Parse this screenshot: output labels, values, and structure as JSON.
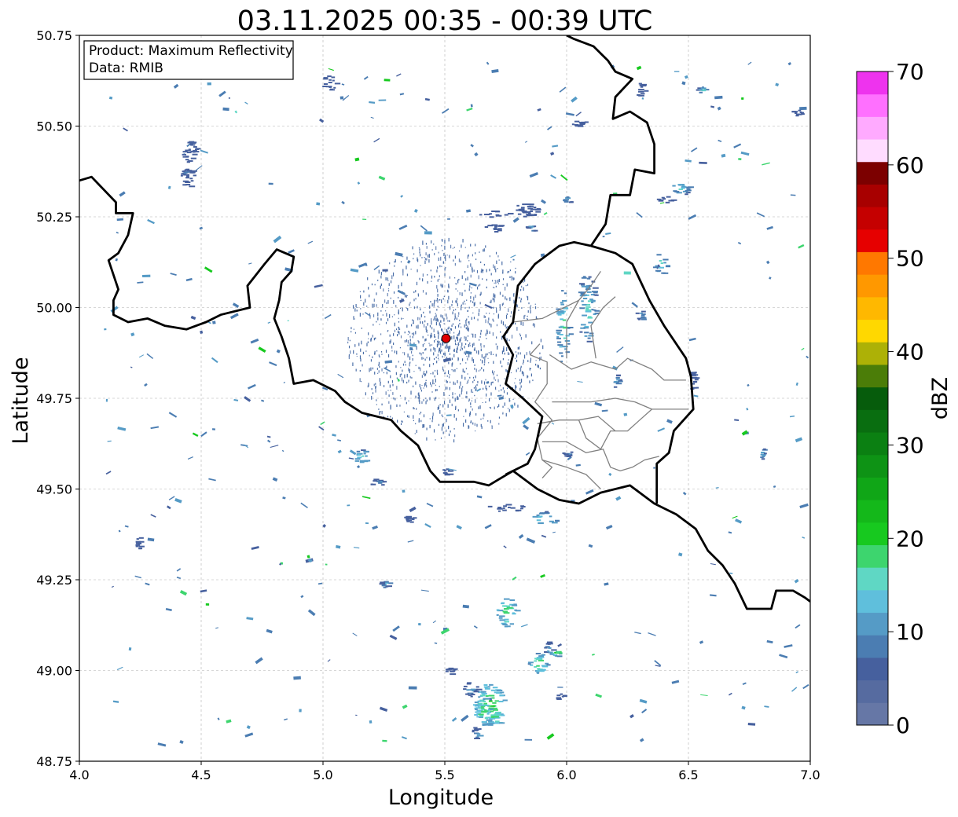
{
  "title": "03.11.2025 00:35 - 00:39 UTC",
  "x_axis": {
    "label": "Longitude",
    "min": 4.0,
    "max": 7.0,
    "ticks": [
      "4.0",
      "4.5",
      "5.0",
      "5.5",
      "6.0",
      "6.5",
      "7.0"
    ]
  },
  "y_axis": {
    "label": "Latitude",
    "min": 48.75,
    "max": 50.75,
    "ticks": [
      "48.75",
      "49.00",
      "49.25",
      "49.50",
      "49.75",
      "50.00",
      "50.25",
      "50.50",
      "50.75"
    ]
  },
  "info_box": {
    "line1": "Product: Maximum Reflectivity",
    "line2": "Data: RMIB"
  },
  "colorbar": {
    "label": "dBZ",
    "min": 0,
    "max": 70,
    "ticks": [
      "0",
      "10",
      "20",
      "30",
      "40",
      "50",
      "60",
      "70"
    ],
    "colors": [
      "#6677a6",
      "#566ba0",
      "#46609e",
      "#4b7db2",
      "#559bc6",
      "#5fbfdc",
      "#5fd7c4",
      "#3dd56e",
      "#17c91f",
      "#14b81a",
      "#10a617",
      "#0e9315",
      "#0b8012",
      "#096e10",
      "#065c0c",
      "#4b7d08",
      "#adb106",
      "#ffd800",
      "#ffb800",
      "#ff9800",
      "#ff7800",
      "#e60000",
      "#c50000",
      "#a80000",
      "#7c0000",
      "#ffdcff",
      "#ffaaff",
      "#ff70ff",
      "#ee33ee"
    ]
  },
  "radar_site": {
    "lon": 5.505,
    "lat": 49.915,
    "color": "#e00000"
  },
  "borders": {
    "national": [
      [
        [
          4.0,
          50.35
        ],
        [
          4.05,
          50.36
        ],
        [
          4.15,
          50.29
        ],
        [
          4.15,
          50.26
        ],
        [
          4.22,
          50.26
        ],
        [
          4.2,
          50.2
        ],
        [
          4.16,
          50.15
        ],
        [
          4.12,
          50.13
        ],
        [
          4.16,
          50.05
        ],
        [
          4.14,
          50.02
        ],
        [
          4.14,
          49.98
        ],
        [
          4.2,
          49.96
        ],
        [
          4.28,
          49.97
        ],
        [
          4.35,
          49.95
        ],
        [
          4.44,
          49.94
        ],
        [
          4.52,
          49.96
        ],
        [
          4.58,
          49.98
        ],
        [
          4.7,
          50.0
        ],
        [
          4.69,
          50.06
        ],
        [
          4.76,
          50.12
        ],
        [
          4.81,
          50.16
        ],
        [
          4.88,
          50.14
        ],
        [
          4.87,
          50.1
        ],
        [
          4.83,
          50.07
        ],
        [
          4.82,
          50.02
        ],
        [
          4.8,
          49.97
        ],
        [
          4.83,
          49.92
        ],
        [
          4.86,
          49.86
        ],
        [
          4.88,
          49.79
        ],
        [
          4.96,
          49.8
        ],
        [
          5.05,
          49.77
        ],
        [
          5.09,
          49.74
        ],
        [
          5.16,
          49.71
        ],
        [
          5.28,
          49.69
        ],
        [
          5.32,
          49.66
        ],
        [
          5.39,
          49.62
        ],
        [
          5.44,
          49.55
        ],
        [
          5.48,
          49.52
        ],
        [
          5.55,
          49.52
        ],
        [
          5.62,
          49.52
        ],
        [
          5.68,
          49.51
        ],
        [
          5.78,
          49.55
        ],
        [
          5.88,
          49.5
        ],
        [
          5.97,
          49.47
        ],
        [
          6.05,
          49.46
        ],
        [
          6.14,
          49.49
        ],
        [
          6.26,
          49.51
        ],
        [
          6.36,
          49.46
        ],
        [
          6.45,
          49.43
        ],
        [
          6.53,
          49.39
        ],
        [
          6.58,
          49.33
        ],
        [
          6.64,
          49.29
        ],
        [
          6.69,
          49.24
        ],
        [
          6.74,
          49.17
        ],
        [
          6.84,
          49.17
        ],
        [
          6.86,
          49.22
        ],
        [
          6.93,
          49.22
        ],
        [
          6.98,
          49.2
        ],
        [
          7.0,
          49.19
        ]
      ],
      [
        [
          6.1,
          50.17
        ],
        [
          6.2,
          50.15
        ],
        [
          6.27,
          50.12
        ],
        [
          6.34,
          50.02
        ],
        [
          6.4,
          49.95
        ],
        [
          6.49,
          49.86
        ],
        [
          6.51,
          49.81
        ],
        [
          6.52,
          49.72
        ],
        [
          6.44,
          49.66
        ],
        [
          6.42,
          49.6
        ],
        [
          6.37,
          49.57
        ],
        [
          6.37,
          49.46
        ]
      ],
      [
        [
          5.75,
          49.54
        ],
        [
          5.84,
          49.57
        ],
        [
          5.87,
          49.61
        ],
        [
          5.9,
          49.7
        ],
        [
          5.82,
          49.75
        ],
        [
          5.75,
          49.79
        ],
        [
          5.78,
          49.87
        ],
        [
          5.74,
          49.92
        ],
        [
          5.78,
          49.96
        ],
        [
          5.8,
          50.06
        ],
        [
          5.87,
          50.12
        ],
        [
          5.97,
          50.17
        ],
        [
          6.03,
          50.18
        ],
        [
          6.1,
          50.17
        ]
      ],
      [
        [
          6.1,
          50.17
        ],
        [
          6.16,
          50.23
        ],
        [
          6.18,
          50.31
        ],
        [
          6.26,
          50.31
        ],
        [
          6.28,
          50.38
        ],
        [
          6.36,
          50.37
        ],
        [
          6.36,
          50.45
        ],
        [
          6.33,
          50.51
        ],
        [
          6.26,
          50.54
        ],
        [
          6.19,
          50.52
        ],
        [
          6.2,
          50.58
        ],
        [
          6.27,
          50.63
        ],
        [
          6.2,
          50.65
        ],
        [
          6.17,
          50.68
        ],
        [
          6.11,
          50.72
        ],
        [
          6.03,
          50.74
        ],
        [
          6.0,
          50.75
        ]
      ]
    ],
    "regional": [
      [
        [
          5.89,
          49.9
        ],
        [
          5.85,
          49.87
        ],
        [
          5.92,
          49.85
        ],
        [
          5.92,
          49.79
        ],
        [
          5.87,
          49.74
        ],
        [
          5.94,
          49.69
        ],
        [
          5.88,
          49.64
        ],
        [
          5.9,
          49.58
        ],
        [
          5.94,
          49.56
        ],
        [
          5.9,
          49.53
        ]
      ],
      [
        [
          5.93,
          49.87
        ],
        [
          6.02,
          49.83
        ],
        [
          6.1,
          49.85
        ],
        [
          6.2,
          49.83
        ],
        [
          6.25,
          49.86
        ],
        [
          6.35,
          49.83
        ],
        [
          6.4,
          49.8
        ],
        [
          6.49,
          49.8
        ]
      ],
      [
        [
          5.94,
          49.74
        ],
        [
          6.1,
          49.74
        ],
        [
          6.2,
          49.75
        ],
        [
          6.28,
          49.74
        ],
        [
          6.35,
          49.72
        ],
        [
          6.5,
          49.72
        ]
      ],
      [
        [
          6.0,
          49.86
        ],
        [
          6.0,
          49.96
        ],
        [
          6.05,
          50.02
        ],
        [
          6.1,
          50.06
        ],
        [
          6.14,
          50.1
        ]
      ],
      [
        [
          5.78,
          49.96
        ],
        [
          5.9,
          49.97
        ],
        [
          5.99,
          50.0
        ],
        [
          6.05,
          50.02
        ]
      ],
      [
        [
          6.12,
          49.86
        ],
        [
          6.1,
          49.95
        ],
        [
          6.15,
          50.0
        ],
        [
          6.2,
          50.03
        ]
      ],
      [
        [
          5.9,
          49.63
        ],
        [
          6.0,
          49.63
        ],
        [
          6.08,
          49.6
        ],
        [
          6.15,
          49.61
        ],
        [
          6.18,
          49.56
        ],
        [
          6.22,
          49.55
        ],
        [
          6.27,
          49.56
        ],
        [
          6.32,
          49.58
        ],
        [
          6.38,
          49.59
        ]
      ],
      [
        [
          5.9,
          49.58
        ],
        [
          6.0,
          49.56
        ],
        [
          6.08,
          49.54
        ],
        [
          6.14,
          49.5
        ]
      ],
      [
        [
          6.14,
          49.61
        ],
        [
          6.18,
          49.66
        ],
        [
          6.25,
          49.66
        ],
        [
          6.3,
          49.69
        ],
        [
          6.35,
          49.72
        ]
      ],
      [
        [
          5.88,
          49.68
        ],
        [
          5.97,
          49.69
        ],
        [
          6.05,
          49.69
        ],
        [
          6.13,
          49.7
        ],
        [
          6.2,
          49.66
        ]
      ],
      [
        [
          6.05,
          49.69
        ],
        [
          6.08,
          49.64
        ],
        [
          6.14,
          49.61
        ]
      ]
    ]
  },
  "echo_blobs": [
    [
      5.68,
      48.91,
      0.06,
      0.06,
      0.96,
      0.85
    ],
    [
      5.65,
      48.89,
      0.04,
      0.04,
      0.92,
      0.8
    ],
    [
      5.6,
      48.95,
      0.03,
      0.02,
      0.6,
      0.82
    ],
    [
      5.75,
      49.16,
      0.04,
      0.04,
      0.93,
      0.85
    ],
    [
      5.88,
      49.02,
      0.04,
      0.03,
      0.9,
      0.8
    ],
    [
      5.63,
      48.83,
      0.02,
      0.02,
      0.6,
      0.8
    ],
    [
      5.92,
      49.06,
      0.02,
      0.02,
      0.6,
      0.7
    ],
    [
      5.97,
      48.93,
      0.02,
      0.01,
      0.4,
      0.7
    ],
    [
      5.52,
      49.0,
      0.02,
      0.01,
      0.3,
      0.7
    ],
    [
      4.45,
      50.43,
      0.03,
      0.03,
      0.3,
      0.8
    ],
    [
      4.44,
      50.36,
      0.03,
      0.03,
      0.3,
      0.8
    ],
    [
      5.02,
      50.62,
      0.03,
      0.02,
      0.3,
      0.8
    ],
    [
      5.83,
      50.27,
      0.05,
      0.02,
      0.3,
      0.8
    ],
    [
      5.7,
      50.26,
      0.06,
      0.01,
      0.3,
      0.5
    ],
    [
      6.05,
      50.51,
      0.03,
      0.01,
      0.3,
      0.8
    ],
    [
      6.46,
      50.33,
      0.04,
      0.02,
      0.75,
      0.7
    ],
    [
      6.38,
      50.12,
      0.03,
      0.03,
      0.8,
      0.6
    ],
    [
      6.08,
      50.0,
      0.04,
      0.1,
      0.75,
      0.5
    ],
    [
      5.98,
      49.95,
      0.03,
      0.1,
      0.8,
      0.5
    ],
    [
      6.3,
      49.98,
      0.02,
      0.02,
      0.55,
      0.6
    ],
    [
      6.52,
      49.8,
      0.02,
      0.03,
      0.3,
      0.8
    ],
    [
      6.2,
      49.8,
      0.02,
      0.02,
      0.6,
      0.6
    ],
    [
      5.9,
      49.42,
      0.06,
      0.02,
      0.8,
      0.6
    ],
    [
      5.75,
      49.45,
      0.08,
      0.01,
      0.3,
      0.5
    ],
    [
      5.15,
      49.59,
      0.03,
      0.02,
      0.8,
      0.8
    ],
    [
      5.22,
      49.52,
      0.03,
      0.01,
      0.55,
      0.7
    ],
    [
      5.35,
      49.42,
      0.02,
      0.01,
      0.3,
      0.8
    ],
    [
      6.8,
      49.6,
      0.01,
      0.02,
      0.7,
      0.7
    ],
    [
      6.55,
      50.6,
      0.02,
      0.01,
      0.7,
      0.7
    ],
    [
      6.4,
      50.3,
      0.03,
      0.01,
      0.3,
      0.6
    ],
    [
      6.0,
      50.3,
      0.02,
      0.01,
      0.7,
      0.6
    ],
    [
      6.3,
      50.6,
      0.02,
      0.02,
      0.3,
      0.6
    ],
    [
      6.94,
      50.54,
      0.03,
      0.01,
      0.3,
      0.7
    ],
    [
      5.7,
      50.22,
      0.05,
      0.01,
      0.3,
      0.5
    ],
    [
      5.85,
      50.22,
      0.02,
      0.01,
      0.7,
      0.6
    ],
    [
      5.5,
      49.55,
      0.02,
      0.01,
      0.3,
      0.6
    ],
    [
      6.0,
      49.6,
      0.02,
      0.01,
      0.55,
      0.6
    ],
    [
      5.25,
      49.24,
      0.02,
      0.01,
      0.7,
      0.6
    ],
    [
      4.24,
      49.35,
      0.01,
      0.02,
      0.3,
      0.8
    ],
    [
      5.95,
      49.05,
      0.02,
      0.01,
      0.95,
      0.7
    ],
    [
      5.7,
      48.87,
      0.03,
      0.02,
      0.98,
      0.8
    ]
  ]
}
